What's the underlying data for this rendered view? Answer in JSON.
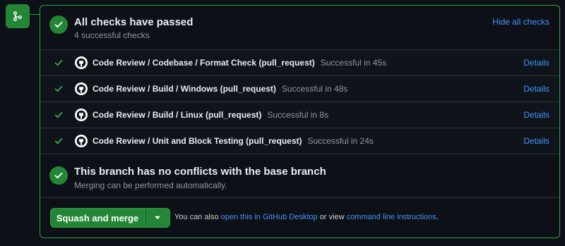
{
  "icons": {
    "merge": "git-merge-icon",
    "check": "check-icon",
    "avatar": "github-mark-icon",
    "dropdown": "triangle-down-icon"
  },
  "colors": {
    "success": "#238636",
    "link": "#4493f8",
    "background": "#0d1117"
  },
  "checks_section": {
    "title": "All checks have passed",
    "subtitle": "4 successful checks",
    "hide_link": "Hide all checks"
  },
  "checks": [
    {
      "name": "Code Review / Codebase / Format Check (pull_request)",
      "status": "Successful in 45s",
      "details": "Details"
    },
    {
      "name": "Code Review / Build / Windows (pull_request)",
      "status": "Successful in 48s",
      "details": "Details"
    },
    {
      "name": "Code Review / Build / Linux (pull_request)",
      "status": "Successful in 8s",
      "details": "Details"
    },
    {
      "name": "Code Review / Unit and Block Testing (pull_request)",
      "status": "Successful in 24s",
      "details": "Details"
    }
  ],
  "conflict_section": {
    "title": "This branch has no conflicts with the base branch",
    "subtitle": "Merging can be performed automatically."
  },
  "merge": {
    "button_label": "Squash and merge",
    "text_prefix": "You can also",
    "desktop_link": "open this in GitHub Desktop",
    "text_middle": "or view",
    "cli_link": "command line instructions",
    "text_suffix": "."
  }
}
